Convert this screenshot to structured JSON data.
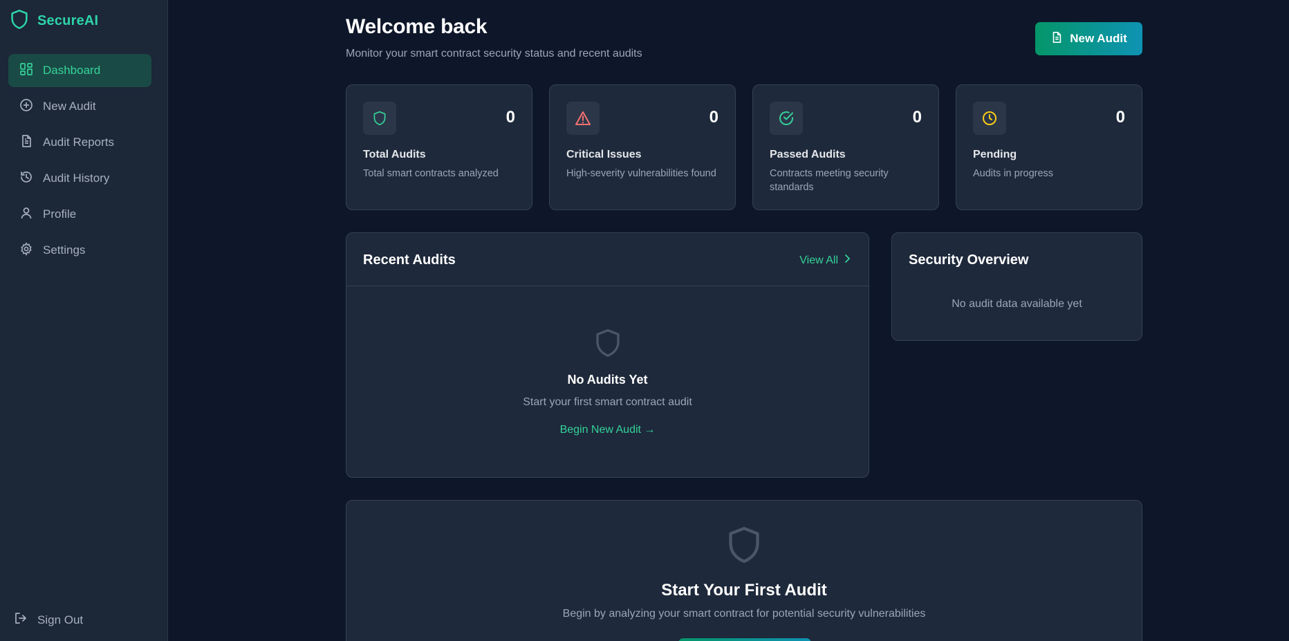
{
  "app": {
    "brand": "SecureAI"
  },
  "sidebar": {
    "items": [
      {
        "label": "Dashboard",
        "icon": "dashboard-icon",
        "active": true
      },
      {
        "label": "New Audit",
        "icon": "plus-circle-icon",
        "active": false
      },
      {
        "label": "Audit Reports",
        "icon": "file-text-icon",
        "active": false
      },
      {
        "label": "Audit History",
        "icon": "history-icon",
        "active": false
      },
      {
        "label": "Profile",
        "icon": "user-icon",
        "active": false
      },
      {
        "label": "Settings",
        "icon": "gear-icon",
        "active": false
      }
    ],
    "signout": "Sign Out"
  },
  "header": {
    "title": "Welcome back",
    "subtitle": "Monitor your smart contract security status and recent audits",
    "new_audit_label": "New Audit"
  },
  "stats": [
    {
      "value": "0",
      "label": "Total Audits",
      "desc": "Total smart contracts analyzed",
      "icon": "shield-icon",
      "color": "#34d399"
    },
    {
      "value": "0",
      "label": "Critical Issues",
      "desc": "High-severity vulnerabilities found",
      "icon": "alert-triangle-icon",
      "color": "#f87171"
    },
    {
      "value": "0",
      "label": "Passed Audits",
      "desc": "Contracts meeting security standards",
      "icon": "check-circle-icon",
      "color": "#34d399"
    },
    {
      "value": "0",
      "label": "Pending",
      "desc": "Audits in progress",
      "icon": "clock-icon",
      "color": "#facc15"
    }
  ],
  "recent": {
    "title": "Recent Audits",
    "view_all": "View All",
    "empty_title": "No Audits Yet",
    "empty_text": "Start your first smart contract audit",
    "begin_link": "Begin New Audit →"
  },
  "overview": {
    "title": "Security Overview",
    "empty": "No audit data available yet"
  },
  "first_audit": {
    "title": "Start Your First Audit",
    "text": "Begin by analyzing your smart contract for potential security vulnerabilities"
  },
  "colors": {
    "accent": "#34d399",
    "background": "#0e1729",
    "card": "#1e293b"
  }
}
